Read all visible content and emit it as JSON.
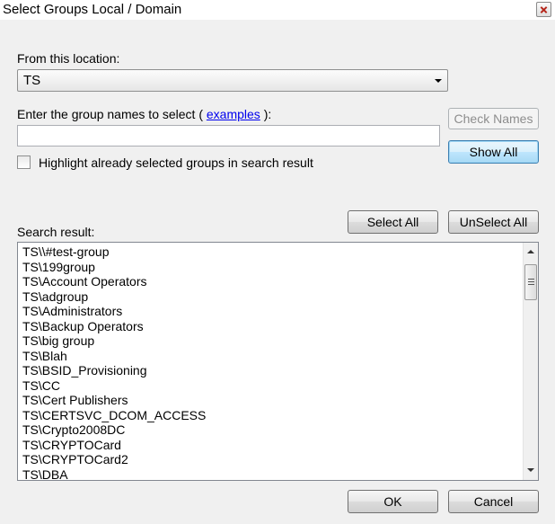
{
  "window": {
    "title": "Select Groups Local / Domain"
  },
  "location": {
    "label": "From this location:",
    "selected": "TS"
  },
  "group_names": {
    "label_prefix": "Enter the group names to select (",
    "link_text": "examples",
    "label_suffix": "):",
    "value": "",
    "placeholder": ""
  },
  "buttons": {
    "check_names": "Check Names",
    "show_all": "Show All",
    "select_all": "Select All",
    "unselect_all": "UnSelect All",
    "ok": "OK",
    "cancel": "Cancel"
  },
  "highlight": {
    "label": "Highlight already selected groups in search result",
    "checked": false
  },
  "search_result": {
    "label": "Search result:",
    "items": [
      "TS\\\\#test-group",
      "TS\\199group",
      "TS\\Account Operators",
      "TS\\adgroup",
      "TS\\Administrators",
      "TS\\Backup Operators",
      "TS\\big group",
      "TS\\Blah",
      "TS\\BSID_Provisioning",
      "TS\\CC",
      "TS\\Cert Publishers",
      "TS\\CERTSVC_DCOM_ACCESS",
      "TS\\Crypto2008DC",
      "TS\\CRYPTOCard",
      "TS\\CRYPTOCard2",
      "TS\\DBA"
    ]
  },
  "icons": {
    "close": "close-icon",
    "dropdown": "chevron-down-icon",
    "scroll_up": "scroll-up-arrow-icon",
    "scroll_down": "scroll-down-arrow-icon"
  }
}
